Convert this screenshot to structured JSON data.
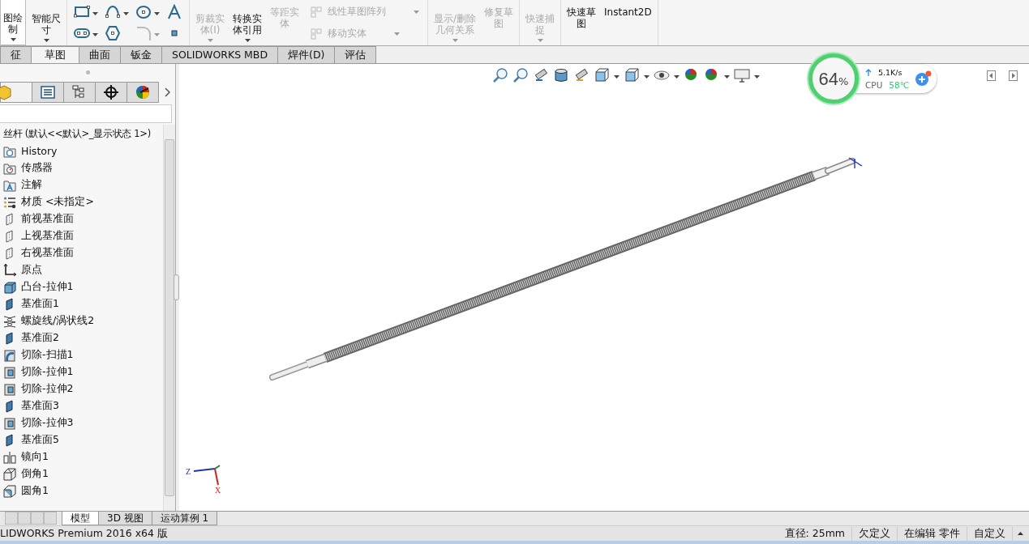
{
  "ribbon": {
    "groups": [
      {
        "items": [
          {
            "kind": "big",
            "lines": [
              "图绘",
              "制"
            ],
            "disabled": false,
            "dropdown": true,
            "boxed": true
          },
          {
            "kind": "big",
            "lines": [
              "智能尺",
              "寸"
            ],
            "disabled": false,
            "dropdown": true,
            "boxed": false
          }
        ]
      },
      {
        "tools": [
          {
            "kind": "rectangle",
            "dropdown": true,
            "disabled": false
          },
          {
            "kind": "arc",
            "dropdown": true,
            "disabled": false
          },
          {
            "kind": "circle",
            "dropdown": true,
            "disabled": false
          },
          {
            "kind": "text",
            "dropdown": false,
            "disabled": false
          },
          {
            "kind": "slot",
            "dropdown": true,
            "disabled": false
          },
          {
            "kind": "polygon",
            "dropdown": false,
            "disabled": false
          },
          {
            "kind": "fillet",
            "dropdown": true,
            "disabled": true
          },
          {
            "kind": "point",
            "dropdown": false,
            "disabled": false
          }
        ]
      },
      {
        "items": [
          {
            "kind": "big",
            "lines": [
              "剪裁实",
              "体(I)"
            ],
            "disabled": true,
            "dropdown": true,
            "boxed": false
          },
          {
            "kind": "big",
            "lines": [
              "转换实",
              "体引用"
            ],
            "disabled": false,
            "dropdown": true,
            "boxed": false
          },
          {
            "kind": "big",
            "lines": [
              "等距实",
              "体"
            ],
            "disabled": true,
            "dropdown": false,
            "boxed": false
          },
          {
            "kind": "small",
            "lines": [
              "线性草图阵列",
              "移动实体"
            ],
            "disabled": true,
            "dropdown": true
          }
        ]
      },
      {
        "items": [
          {
            "kind": "big",
            "lines": [
              "显示/删除",
              "几何关系"
            ],
            "disabled": true,
            "dropdown": true,
            "boxed": false
          },
          {
            "kind": "big",
            "lines": [
              "修复草",
              "图"
            ],
            "disabled": true,
            "dropdown": false,
            "boxed": false
          }
        ]
      },
      {
        "items": [
          {
            "kind": "big",
            "lines": [
              "快速捕",
              "捉"
            ],
            "disabled": true,
            "dropdown": true,
            "boxed": false
          }
        ]
      },
      {
        "items": [
          {
            "kind": "big",
            "lines": [
              "快速草",
              "图"
            ],
            "disabled": false,
            "dropdown": false,
            "boxed": false
          },
          {
            "kind": "big",
            "lines": [
              "Instant2D"
            ],
            "disabled": false,
            "dropdown": false,
            "boxed": false
          }
        ]
      }
    ]
  },
  "command_tabs": [
    {
      "label": "征",
      "selected": false
    },
    {
      "label": "草图",
      "selected": true
    },
    {
      "label": "曲面",
      "selected": false
    },
    {
      "label": "钣金",
      "selected": false
    },
    {
      "label": "SOLIDWORKS MBD",
      "selected": false
    },
    {
      "label": "焊件(D)",
      "selected": false
    },
    {
      "label": "评估",
      "selected": false
    }
  ],
  "panel_tabs": [
    {
      "kind": "cube",
      "selected": true
    },
    {
      "kind": "list",
      "selected": false
    },
    {
      "kind": "config",
      "selected": false
    },
    {
      "kind": "crosshair",
      "selected": false
    },
    {
      "kind": "wheel",
      "selected": false
    }
  ],
  "feature_tree": {
    "root": "丝杆 (默认<<默认>_显示状态 1>)",
    "items": [
      {
        "kind": "history",
        "label": "History"
      },
      {
        "kind": "sensor",
        "label": "传感器"
      },
      {
        "kind": "annotation",
        "label": "注解"
      },
      {
        "kind": "material",
        "label": "材质 <未指定>"
      },
      {
        "kind": "plane",
        "label": "前视基准面"
      },
      {
        "kind": "plane",
        "label": "上视基准面"
      },
      {
        "kind": "plane",
        "label": "右视基准面"
      },
      {
        "kind": "origin",
        "label": "原点"
      },
      {
        "kind": "boss",
        "label": "凸台-拉伸1"
      },
      {
        "kind": "refplane",
        "label": "基准面1"
      },
      {
        "kind": "helix",
        "label": "螺旋线/涡状线2"
      },
      {
        "kind": "refplane",
        "label": "基准面2"
      },
      {
        "kind": "sweep",
        "label": "切除-扫描1"
      },
      {
        "kind": "cut",
        "label": "切除-拉伸1"
      },
      {
        "kind": "cut",
        "label": "切除-拉伸2"
      },
      {
        "kind": "refplane",
        "label": "基准面3"
      },
      {
        "kind": "cut",
        "label": "切除-拉伸3"
      },
      {
        "kind": "refplane",
        "label": "基准面5"
      },
      {
        "kind": "mirror",
        "label": "镜向1"
      },
      {
        "kind": "chamfer",
        "label": "倒角1"
      },
      {
        "kind": "fillet",
        "label": "圆角1"
      }
    ]
  },
  "triad": {
    "z_label": "Z",
    "x_label": "X"
  },
  "monitor": {
    "percent": "64",
    "unit": "%",
    "speed": "5.1K/s",
    "cpu_label": "CPU",
    "temperature": "58℃"
  },
  "bottom_tabs": [
    {
      "label": "模型",
      "selected": true
    },
    {
      "label": "3D 视图",
      "selected": false
    },
    {
      "label": "运动算例 1",
      "selected": false
    }
  ],
  "status_bar": {
    "app": "LIDWORKS Premium 2016 x64 版",
    "fields": [
      "直径: 25mm",
      "欠定义",
      "在编辑 零件",
      "自定义"
    ]
  }
}
